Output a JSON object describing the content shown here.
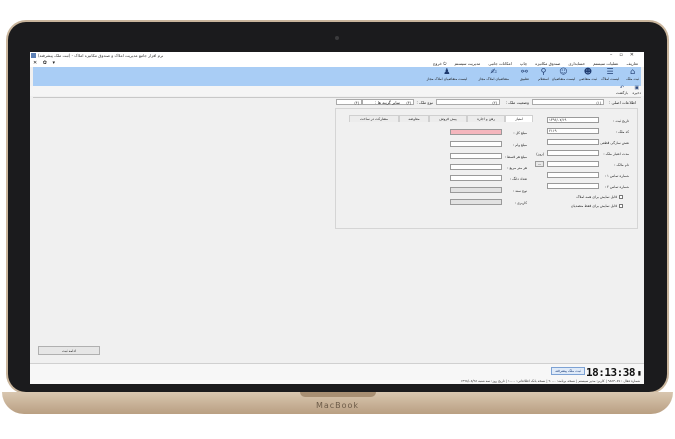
{
  "device": {
    "label": "MacBook"
  },
  "window": {
    "title": "نرم افزار جامع مدیریت املاک و صندوق مکانیزه املاک - (ثبت ملک پیشرفته)",
    "controls": [
      "–",
      "▫",
      "✕"
    ]
  },
  "menu": {
    "items": [
      "تعاریف",
      "عملیات سیستم",
      "حسابداری",
      "صندوق مکانیزه",
      "چاپ",
      "امکانات جانبی",
      "مدیریت سیستم",
      "خروج"
    ],
    "left_controls": "✕ ✿ ▾"
  },
  "ribbon": {
    "buttons": [
      {
        "label": "ثبت ملک",
        "icon": "home-icon"
      },
      {
        "label": "لیست املاک",
        "icon": "list-icon"
      },
      {
        "label": "ثبت متقاضی",
        "icon": "user-add-icon"
      },
      {
        "label": "لیست متقاضیان",
        "icon": "users-icon"
      },
      {
        "label": "استعلام",
        "icon": "search-icon"
      },
      {
        "label": "تطبیق",
        "icon": "link-icon"
      },
      {
        "label": "متقاضیان املاک مجاز",
        "icon": "hand-icon"
      },
      {
        "label": "لیست متقاضیان املاک مجاز",
        "icon": "people-icon"
      }
    ]
  },
  "subbar": {
    "buttons": [
      {
        "label": "ذخیره",
        "icon": "save-icon"
      },
      {
        "label": "بازگشت",
        "icon": "back-icon"
      }
    ]
  },
  "formbar": {
    "fields": [
      {
        "label": "اطلاعات اصلی :",
        "value": "(۱)"
      },
      {
        "label": "وضعیت ملک :",
        "value": "(۲)"
      },
      {
        "label": "نوع ملک :",
        "value": "(۳)"
      },
      {
        "label": "سایر گزینه ها :",
        "value": "(۴)"
      }
    ]
  },
  "leftform": {
    "fields": [
      {
        "label": "تاریخ ثبت :",
        "value": "۱۳۹۶/۰۷/۱۹"
      },
      {
        "label": "کد ملک :",
        "value": "۲۱۱۹"
      },
      {
        "label": "نقش سازگی قطعی :",
        "value": ""
      },
      {
        "label": "مدت اعتبار ملک :",
        "value": "",
        "suffix": "(روز)"
      },
      {
        "label": "نام مالک :",
        "value": "",
        "button": "..."
      },
      {
        "label": "شماره تماس ۱ :",
        "value": ""
      },
      {
        "label": "شماره تماس ۲ :",
        "value": ""
      }
    ],
    "checkboxes": [
      {
        "label": "قابل نمایش برای همه املاک"
      },
      {
        "label": "قابل نمایش برای فقط متصدیان"
      }
    ]
  },
  "tabs": {
    "items": [
      "امتیاز",
      "رهن و اجاره",
      "پیش فروش",
      "معاوضه",
      "مشارکت در ساخت"
    ],
    "active": 0
  },
  "tabform": {
    "fields": [
      {
        "label": "مبلغ کل :",
        "value": "",
        "style": "pink"
      },
      {
        "label": "مبلغ وام :",
        "value": "",
        "style": ""
      },
      {
        "label": "مبلغ هر قسط :",
        "value": "",
        "style": ""
      },
      {
        "label": "هر متر مربع :",
        "value": "",
        "style": ""
      },
      {
        "label": "تعداد دانگ :",
        "value": "",
        "style": ""
      },
      {
        "label": "نوع سند :",
        "value": "",
        "style": "disabled"
      },
      {
        "label": "کاربری :",
        "value": "",
        "style": "disabled"
      }
    ]
  },
  "footer": {
    "left_button": "ادامه ثبت",
    "status_button": "ثبت ملک پیشرفته",
    "clock": "18:13:38",
    "status_line": "شماره فعال : ۹۸۸۳۰۸۷ | کاربر: مدیر سیستم | نسخه برنامه: ۲.۰.۰ | نسخه بانک اطلاعاتی: ۱.۰.۰ | تاریخ روز: سه شنبه ۱۳۹۸/۰۸/۲۸"
  }
}
